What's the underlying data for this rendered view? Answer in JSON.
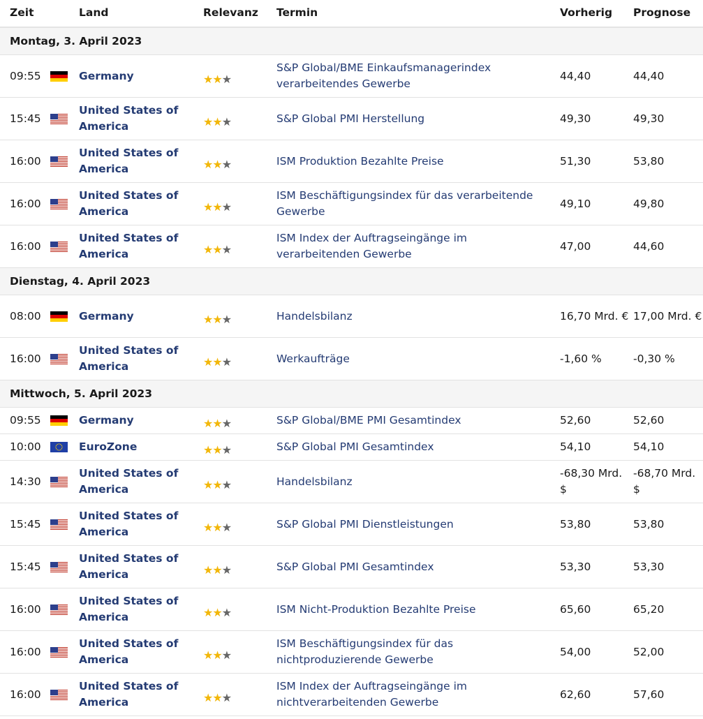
{
  "header": {
    "time": "Zeit",
    "country": "Land",
    "relevance": "Relevanz",
    "event": "Termin",
    "previous": "Vorherig",
    "forecast": "Prognose"
  },
  "colors": {
    "link": "#243b73",
    "star_active": "#f2b70a",
    "star_inactive": "#666666",
    "date_row_bg": "#f5f5f5"
  },
  "rows": [
    {
      "type": "date",
      "label": "Montag, 3. April 2023"
    },
    {
      "type": "event",
      "time": "09:55",
      "flag": "flag-germany-icon",
      "country": "Germany",
      "stars": 2,
      "event": "S&P Global/BME Einkaufsmanagerindex verarbeitendes Gewerbe",
      "previous": "44,40",
      "forecast": "44,40"
    },
    {
      "type": "event",
      "time": "15:45",
      "flag": "flag-usa-icon",
      "country": "United States of America",
      "stars": 2,
      "event": "S&P Global PMI Herstellung",
      "previous": "49,30",
      "forecast": "49,30"
    },
    {
      "type": "event",
      "time": "16:00",
      "flag": "flag-usa-icon",
      "country": "United States of America",
      "stars": 2,
      "event": "ISM Produktion Bezahlte Preise",
      "previous": "51,30",
      "forecast": "53,80"
    },
    {
      "type": "event",
      "time": "16:00",
      "flag": "flag-usa-icon",
      "country": "United States of America",
      "stars": 2,
      "event": "ISM Beschäftigungsindex für das verarbeitende Gewerbe",
      "previous": "49,10",
      "forecast": "49,80"
    },
    {
      "type": "event",
      "time": "16:00",
      "flag": "flag-usa-icon",
      "country": "United States of America",
      "stars": 2,
      "event": "ISM Index der Auftragseingänge im verarbeitenden Gewerbe",
      "previous": "47,00",
      "forecast": "44,60"
    },
    {
      "type": "date",
      "label": "Dienstag, 4. April 2023"
    },
    {
      "type": "event",
      "time": "08:00",
      "flag": "flag-germany-icon",
      "country": "Germany",
      "stars": 2,
      "event": "Handelsbilanz",
      "previous": "16,70 Mrd. €",
      "forecast": "17,00 Mrd. €"
    },
    {
      "type": "event",
      "time": "16:00",
      "flag": "flag-usa-icon",
      "country": "United States of America",
      "stars": 2,
      "event": "Werkaufträge",
      "previous": "-1,60 %",
      "forecast": "-0,30 %"
    },
    {
      "type": "date",
      "label": "Mittwoch, 5. April 2023"
    },
    {
      "type": "event",
      "time": "09:55",
      "flag": "flag-germany-icon",
      "country": "Germany",
      "stars": 2,
      "event": "S&P Global/BME PMI Gesamtindex",
      "previous": "52,60",
      "forecast": "52,60"
    },
    {
      "type": "event",
      "time": "10:00",
      "flag": "flag-eurozone-icon",
      "country": "EuroZone",
      "stars": 2,
      "event": "S&P Global PMI Gesamtindex",
      "previous": "54,10",
      "forecast": "54,10"
    },
    {
      "type": "event",
      "time": "14:30",
      "flag": "flag-usa-icon",
      "country": "United States of America",
      "stars": 2,
      "event": "Handelsbilanz",
      "previous": "-68,30 Mrd. $",
      "forecast": "-68,70 Mrd. $"
    },
    {
      "type": "event",
      "time": "15:45",
      "flag": "flag-usa-icon",
      "country": "United States of America",
      "stars": 2,
      "event": "S&P Global PMI Dienstleistungen",
      "previous": "53,80",
      "forecast": "53,80"
    },
    {
      "type": "event",
      "time": "15:45",
      "flag": "flag-usa-icon",
      "country": "United States of America",
      "stars": 2,
      "event": "S&P Global PMI Gesamtindex",
      "previous": "53,30",
      "forecast": "53,30"
    },
    {
      "type": "event",
      "time": "16:00",
      "flag": "flag-usa-icon",
      "country": "United States of America",
      "stars": 2,
      "event": "ISM Nicht-Produktion Bezahlte Preise",
      "previous": "65,60",
      "forecast": "65,20"
    },
    {
      "type": "event",
      "time": "16:00",
      "flag": "flag-usa-icon",
      "country": "United States of America",
      "stars": 2,
      "event": "ISM Beschäftigungsindex für das nichtproduzierende Gewerbe",
      "previous": "54,00",
      "forecast": "52,00"
    },
    {
      "type": "event",
      "time": "16:00",
      "flag": "flag-usa-icon",
      "country": "United States of America",
      "stars": 2,
      "event": "ISM Index der Auftragseingänge im nichtverarbeitenden Gewerbe",
      "previous": "62,60",
      "forecast": "57,60"
    }
  ]
}
